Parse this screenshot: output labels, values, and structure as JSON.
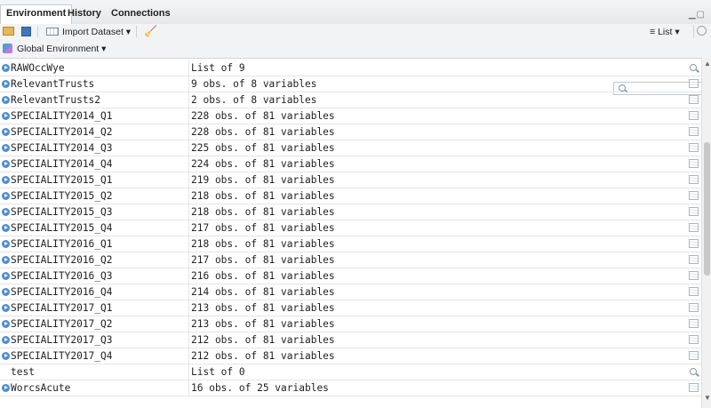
{
  "tabs": [
    {
      "label": "Environment",
      "active": true
    },
    {
      "label": "History",
      "active": false
    },
    {
      "label": "Connections",
      "active": false
    }
  ],
  "toolbar": {
    "import_dataset_label": "Import Dataset",
    "view_mode_label": "List"
  },
  "env_selector": {
    "label": "Global Environment"
  },
  "search": {
    "placeholder": ""
  },
  "rows": [
    {
      "name": "RAWOccWye",
      "value": "List of 9",
      "icon": "magnifier-icon",
      "expandable": true
    },
    {
      "name": "RelevantTrusts",
      "value": "9 obs. of 8 variables",
      "icon": "table-icon",
      "expandable": true
    },
    {
      "name": "RelevantTrusts2",
      "value": "2 obs. of 8 variables",
      "icon": "table-icon",
      "expandable": true
    },
    {
      "name": "SPECIALITY2014_Q1",
      "value": "228 obs. of 81 variables",
      "icon": "table-icon",
      "expandable": true
    },
    {
      "name": "SPECIALITY2014_Q2",
      "value": "228 obs. of 81 variables",
      "icon": "table-icon",
      "expandable": true
    },
    {
      "name": "SPECIALITY2014_Q3",
      "value": "225 obs. of 81 variables",
      "icon": "table-icon",
      "expandable": true
    },
    {
      "name": "SPECIALITY2014_Q4",
      "value": "224 obs. of 81 variables",
      "icon": "table-icon",
      "expandable": true
    },
    {
      "name": "SPECIALITY2015_Q1",
      "value": "219 obs. of 81 variables",
      "icon": "table-icon",
      "expandable": true
    },
    {
      "name": "SPECIALITY2015_Q2",
      "value": "218 obs. of 81 variables",
      "icon": "table-icon",
      "expandable": true
    },
    {
      "name": "SPECIALITY2015_Q3",
      "value": "218 obs. of 81 variables",
      "icon": "table-icon",
      "expandable": true
    },
    {
      "name": "SPECIALITY2015_Q4",
      "value": "217 obs. of 81 variables",
      "icon": "table-icon",
      "expandable": true
    },
    {
      "name": "SPECIALITY2016_Q1",
      "value": "218 obs. of 81 variables",
      "icon": "table-icon",
      "expandable": true
    },
    {
      "name": "SPECIALITY2016_Q2",
      "value": "217 obs. of 81 variables",
      "icon": "table-icon",
      "expandable": true
    },
    {
      "name": "SPECIALITY2016_Q3",
      "value": "216 obs. of 81 variables",
      "icon": "table-icon",
      "expandable": true
    },
    {
      "name": "SPECIALITY2016_Q4",
      "value": "214 obs. of 81 variables",
      "icon": "table-icon",
      "expandable": true
    },
    {
      "name": "SPECIALITY2017_Q1",
      "value": "213 obs. of 81 variables",
      "icon": "table-icon",
      "expandable": true
    },
    {
      "name": "SPECIALITY2017_Q2",
      "value": "213 obs. of 81 variables",
      "icon": "table-icon",
      "expandable": true
    },
    {
      "name": "SPECIALITY2017_Q3",
      "value": "212 obs. of 81 variables",
      "icon": "table-icon",
      "expandable": true
    },
    {
      "name": "SPECIALITY2017_Q4",
      "value": "212 obs. of 81 variables",
      "icon": "table-icon",
      "expandable": true
    },
    {
      "name": "test",
      "value": "List of 0",
      "icon": "magnifier-icon",
      "expandable": false
    },
    {
      "name": "WorcsAcute",
      "value": "16 obs. of 25 variables",
      "icon": "table-icon",
      "expandable": true
    }
  ],
  "colors": {
    "accent": "#4a8fd0",
    "row_border": "#e3e5e8",
    "toolbar_bg": "#f2f3f4"
  }
}
